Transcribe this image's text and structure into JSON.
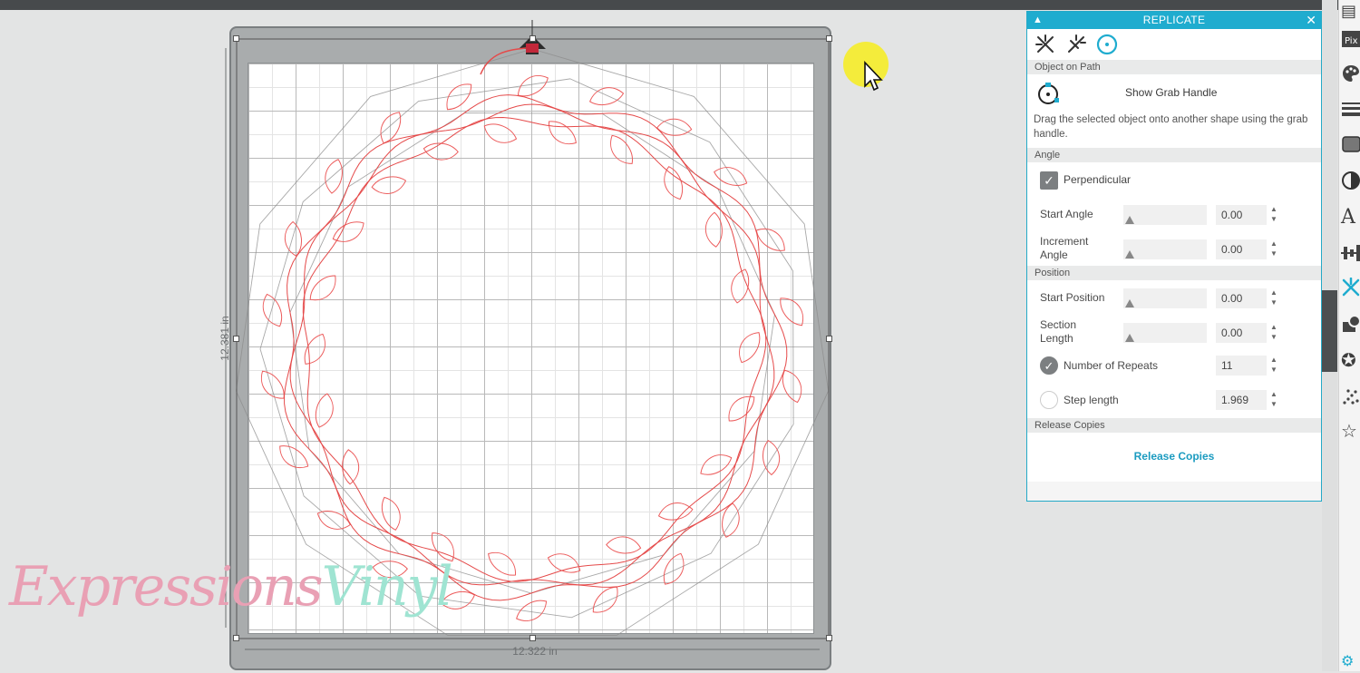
{
  "canvas": {
    "width_label": "12.322 in",
    "height_label": "12.381 in"
  },
  "watermark": {
    "part1": "Expressions",
    "part2": "Vinyl"
  },
  "panel": {
    "title": "REPLICATE",
    "collapse_icon": "chevron-up-icon",
    "close_icon": "close-icon",
    "mode_icons": [
      "replicate-icon",
      "mirror-replicate-icon",
      "object-on-path-icon"
    ],
    "section_object_on_path": "Object on Path",
    "grab_handle_label": "Show Grab Handle",
    "description": "Drag the selected object onto another shape using the grab handle.",
    "section_angle": "Angle",
    "perpendicular_label": "Perpendicular",
    "perpendicular_checked": true,
    "start_angle": {
      "label": "Start Angle",
      "value": "0.00"
    },
    "increment_angle": {
      "label": "Increment Angle",
      "value": "0.00"
    },
    "section_position": "Position",
    "start_position": {
      "label": "Start Position",
      "value": "0.00"
    },
    "section_length": {
      "label": "Section Length",
      "value": "0.00"
    },
    "number_of_repeats": {
      "label": "Number of Repeats",
      "value": "11",
      "selected": true
    },
    "step_length": {
      "label": "Step length",
      "value": "1.969",
      "selected": false
    },
    "section_release": "Release Copies",
    "release_button": "Release Copies"
  },
  "colors": {
    "accent": "#1faccf",
    "cut_line": "#ec5b5b"
  }
}
